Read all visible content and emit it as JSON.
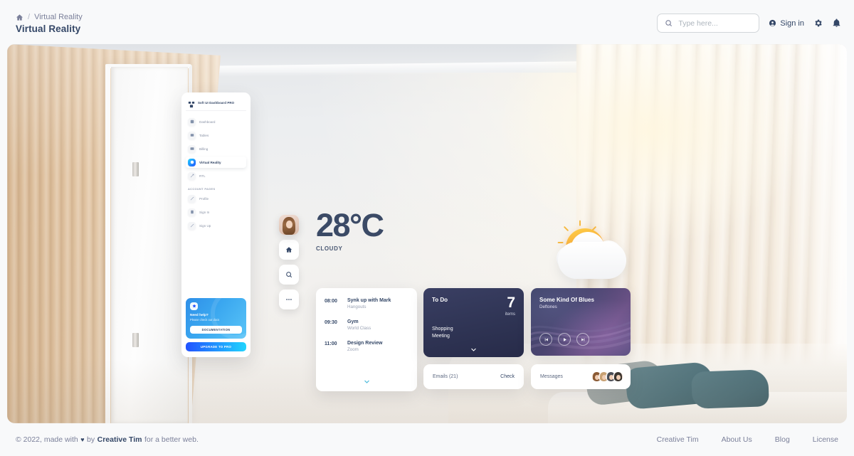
{
  "header": {
    "breadcrumb": {
      "home_icon": "home-icon",
      "separator": "/",
      "parent": "Virtual Reality"
    },
    "page_title": "Virtual Reality",
    "search": {
      "placeholder": "Type here...",
      "value": "",
      "icon": "search-icon"
    },
    "sign_in_label": "Sign in",
    "sign_in_icon": "account-circle-icon",
    "settings_icon": "gear-icon",
    "notifications_icon": "bell-icon"
  },
  "vr_sidebar": {
    "brand": "Soft UI Dashboard PRO",
    "brand_icon": "dashboard-logo-icon",
    "nav_items": [
      {
        "label": "Dashboard",
        "icon": "dashboard-icon",
        "active": false
      },
      {
        "label": "Tables",
        "icon": "table-icon",
        "active": false
      },
      {
        "label": "Billing",
        "icon": "credit-card-icon",
        "active": false
      },
      {
        "label": "Virtual Reality",
        "icon": "vr-icon",
        "active": true
      },
      {
        "label": "RTL",
        "icon": "rtl-icon",
        "active": false
      }
    ],
    "section_label": "ACCOUNT PAGES",
    "account_items": [
      {
        "label": "Profile",
        "icon": "profile-icon"
      },
      {
        "label": "Sign In",
        "icon": "sign-in-icon"
      },
      {
        "label": "Sign Up",
        "icon": "sign-up-icon"
      }
    ],
    "help_card": {
      "badge_icon": "star-icon",
      "title": "Need help?",
      "subtitle": "Please check our docs",
      "button_label": "DOCUMENTATION"
    },
    "upgrade_label": "UPGRADE TO PRO"
  },
  "rail": {
    "avatar": "user-avatar",
    "buttons": [
      {
        "icon": "home-icon",
        "name": "rail-home-button"
      },
      {
        "icon": "search-icon",
        "name": "rail-search-button"
      },
      {
        "icon": "more-horizontal-icon",
        "name": "rail-more-button"
      }
    ]
  },
  "weather": {
    "temperature": "28°C",
    "condition": "CLOUDY",
    "icon": "sun-behind-cloud-icon"
  },
  "schedule": {
    "rows": [
      {
        "time": "08:00",
        "title": "Synk up with Mark",
        "subtitle": "Hangouts"
      },
      {
        "time": "09:30",
        "title": "Gym",
        "subtitle": "World Class"
      },
      {
        "time": "11:00",
        "title": "Design Review",
        "subtitle": "Zoom"
      }
    ],
    "expand_icon": "chevron-down-icon"
  },
  "todo": {
    "title": "To Do",
    "count": "7",
    "count_label": "items",
    "items": [
      "Shopping",
      "Meeting"
    ],
    "expand_icon": "chevron-down-icon"
  },
  "music": {
    "title": "Some Kind Of Blues",
    "artist": "Deftones",
    "controls": [
      {
        "icon": "skip-previous-icon",
        "name": "previous-track-button"
      },
      {
        "icon": "play-icon",
        "name": "play-button"
      },
      {
        "icon": "skip-next-icon",
        "name": "next-track-button"
      }
    ]
  },
  "emails": {
    "label": "Emails (21)",
    "action": "Check"
  },
  "messages": {
    "label": "Messages",
    "avatar_count": 4
  },
  "footer": {
    "copyright_prefix": "© 2022, made with",
    "heart": "♥",
    "by": "by",
    "brand": "Creative Tim",
    "copyright_suffix": "for a better web.",
    "links": [
      "Creative Tim",
      "About Us",
      "Blog",
      "License"
    ]
  },
  "colors": {
    "accent_blue": "#2152ff",
    "accent_cyan": "#21d4fd",
    "text_dark": "#344767",
    "text_muted": "#7b809a",
    "page_bg": "#f8f9fa"
  }
}
